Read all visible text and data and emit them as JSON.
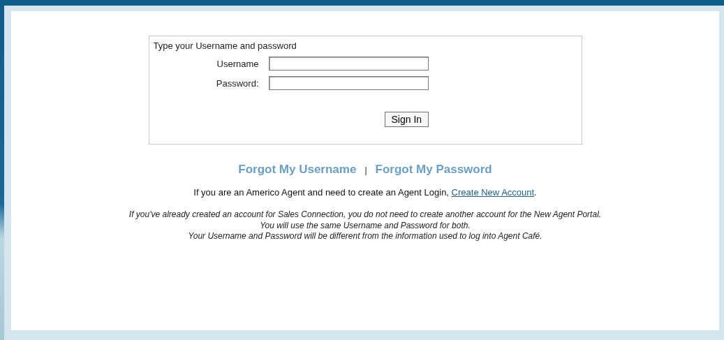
{
  "login_box": {
    "prompt": "Type your Username and password",
    "fields": [
      {
        "label": "Username"
      },
      {
        "label": "Password:"
      }
    ],
    "submit_button": "Sign In"
  },
  "recovery_links": [
    "Forgot My Username",
    "Forgot My Password"
  ],
  "link_separator": "|",
  "create_account": {
    "text": "If you are an Americo Agent and need to create an Agent Login, ",
    "link": "Create New Account",
    "suffix": "."
  },
  "notes": [
    "If you've already created an account for Sales Connection, you do not need to create another account for the New Agent Portal.",
    "You will use the same Username and Password for both.",
    "Your Username and Password will be different from the information used to log into Agent Café."
  ]
}
